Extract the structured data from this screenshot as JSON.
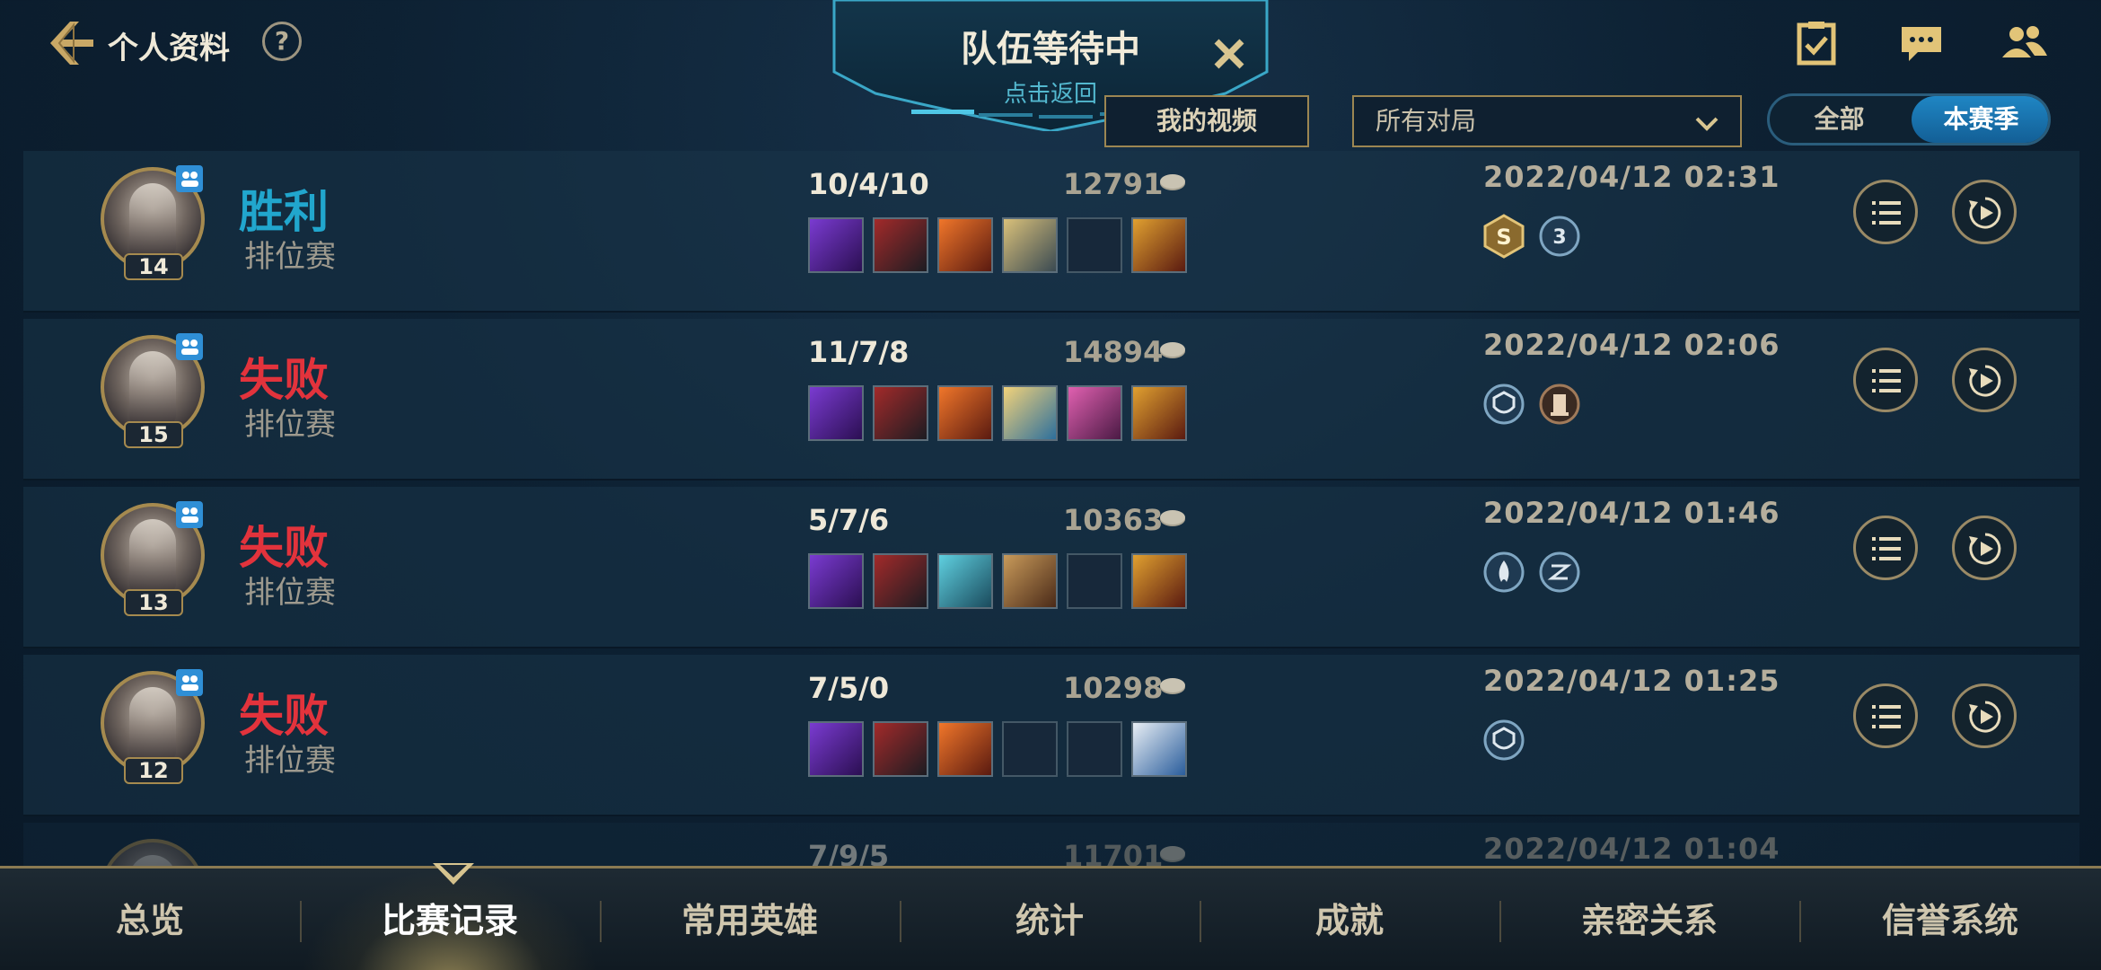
{
  "header": {
    "title": "个人资料",
    "help": "?"
  },
  "queue": {
    "title": "队伍等待中",
    "subtitle": "点击返回"
  },
  "filters": {
    "my_videos": "我的视频",
    "match_filter": "所有对局",
    "segment_all": "全部",
    "segment_season": "本赛季",
    "segment_selected": "本赛季"
  },
  "matches": [
    {
      "result": "胜利",
      "outcome": "win",
      "mode": "排位赛",
      "level": "14",
      "kda": "10/4/10",
      "gold": "12791",
      "date": "2022/04/12 02:31",
      "items": [
        "purple-sword",
        "dark-axe",
        "flame-blade",
        "golden-mace",
        "empty",
        "trinket-skull"
      ],
      "badges": [
        "s-rank-badge",
        "triple-badge"
      ]
    },
    {
      "result": "失败",
      "outcome": "lose",
      "mode": "排位赛",
      "level": "15",
      "kda": "11/7/8",
      "gold": "14894",
      "date": "2022/04/12 02:06",
      "items": [
        "purple-sword",
        "dark-axe",
        "flame-blade",
        "winged-staff",
        "pink-gauntlet",
        "trinket-skull"
      ],
      "badges": [
        "guardian-badge",
        "tower-badge"
      ]
    },
    {
      "result": "失败",
      "outcome": "lose",
      "mode": "排位赛",
      "level": "13",
      "kda": "5/7/6",
      "gold": "10363",
      "date": "2022/04/12 01:46",
      "items": [
        "purple-sword",
        "dark-axe",
        "crystal-armor",
        "war-hammer",
        "empty",
        "trinket-skull"
      ],
      "badges": [
        "flame-badge",
        "swirl-badge"
      ]
    },
    {
      "result": "失败",
      "outcome": "lose",
      "mode": "排位赛",
      "level": "12",
      "kda": "7/5/0",
      "gold": "10298",
      "date": "2022/04/12 01:25",
      "items": [
        "purple-sword",
        "dark-axe",
        "flame-blade",
        "empty",
        "empty",
        "wolf-trinket"
      ],
      "badges": [
        "guardian-badge"
      ]
    },
    {
      "result": "",
      "outcome": "partial",
      "mode": "",
      "level": "",
      "kda": "7/9/5",
      "gold": "11701",
      "date": "2022/04/12 01:04",
      "items": [],
      "badges": []
    }
  ],
  "bottom_nav": {
    "tabs": [
      "总览",
      "比赛记录",
      "常用英雄",
      "统计",
      "成就",
      "亲密关系",
      "信誉系统"
    ],
    "active": "比赛记录"
  },
  "colors": {
    "win": "#21a6cd",
    "lose": "#e2333c",
    "gold_border": "#9c8652",
    "accent_blue": "#1f86c4"
  }
}
